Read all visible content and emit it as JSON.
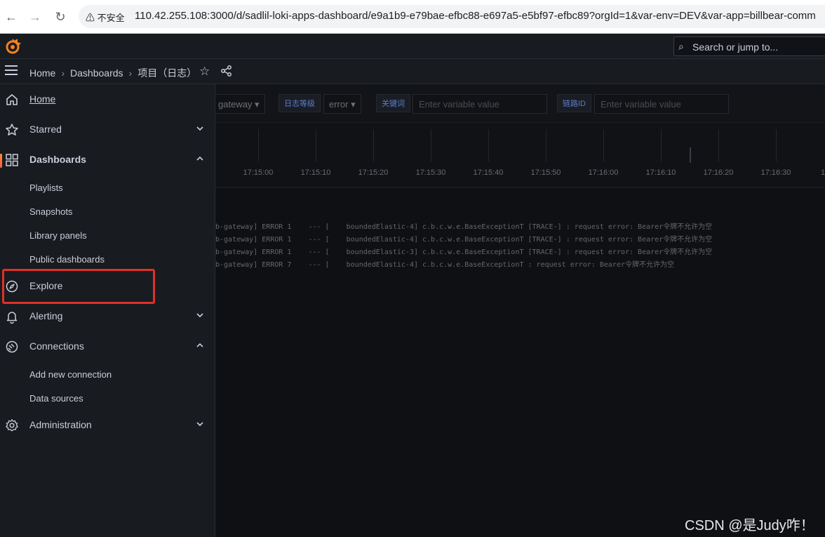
{
  "browser": {
    "back": "←",
    "forward": "→",
    "reload": "↻",
    "insecure_label": "不安全",
    "url": "110.42.255.108:3000/d/sadlil-loki-apps-dashboard/e9a1b9-e79bae-efbc88-e697a5-e5bf97-efbc89?orgId=1&var-env=DEV&var-app=billbear-comm"
  },
  "topbar": {
    "search_placeholder": "Search or jump to..."
  },
  "breadcrumb": {
    "items": [
      "Home",
      "Dashboards",
      "项目（日志）"
    ]
  },
  "sidebar": {
    "items": [
      {
        "label": "Home",
        "icon": "home-icon"
      },
      {
        "label": "Starred",
        "icon": "star-icon"
      },
      {
        "label": "Dashboards",
        "icon": "apps-icon"
      },
      {
        "label": "Explore",
        "icon": "compass-icon"
      },
      {
        "label": "Alerting",
        "icon": "bell-icon"
      },
      {
        "label": "Connections",
        "icon": "plug-icon"
      },
      {
        "label": "Administration",
        "icon": "cog-icon"
      }
    ],
    "dashboards_sub": [
      "Playlists",
      "Snapshots",
      "Library panels",
      "Public dashboards"
    ],
    "connections_sub": [
      "Add new connection",
      "Data sources"
    ]
  },
  "variables": {
    "app_value": "gateway",
    "level_label": "日志等级",
    "level_value": "error",
    "keyword_label": "关键词",
    "keyword_placeholder": "Enter variable value",
    "trace_label": "链路ID",
    "trace_placeholder": "Enter variable value"
  },
  "timeline": {
    "ticks": [
      "17:15:00",
      "17:15:10",
      "17:15:20",
      "17:15:30",
      "17:15:40",
      "17:15:50",
      "17:16:00",
      "17:16:10",
      "17:16:20",
      "17:16:30",
      "1"
    ]
  },
  "logs": [
    "b-gateway] ERROR 1    --- [    boundedElastic-4] c.b.c.w.e.BaseExceptionT [TRACE-] : request error: Bearer令牌不允许为空",
    "b-gateway] ERROR 1    --- [    boundedElastic-4] c.b.c.w.e.BaseExceptionT [TRACE-] : request error: Bearer令牌不允许为空",
    "b-gateway] ERROR 1    --- [    boundedElastic-3] c.b.c.w.e.BaseExceptionT [TRACE-] : request error: Bearer令牌不允许为空",
    "b-gateway] ERROR 7    --- [    boundedElastic-4] c.b.c.w.e.BaseExceptionT : request error: Bearer令牌不允许为空"
  ],
  "watermark": "CSDN @是Judy咋！",
  "colors": {
    "highlight": "#e0302a",
    "accent": "#ff8833"
  }
}
